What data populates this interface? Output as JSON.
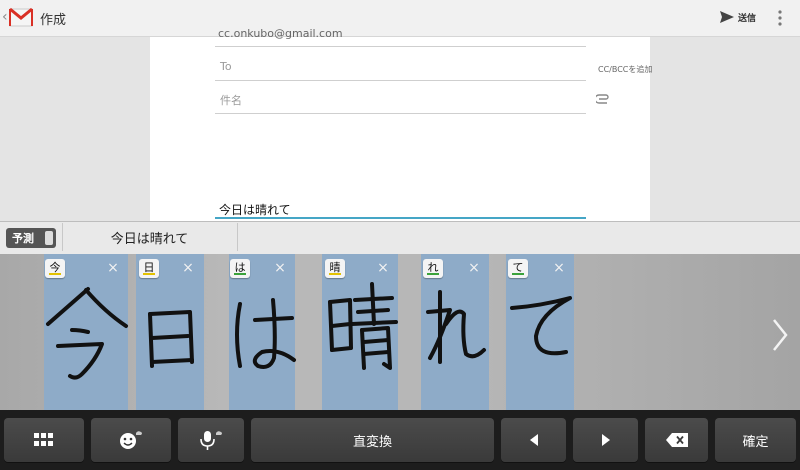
{
  "header": {
    "title": "作成",
    "send_label": "送信",
    "app_icon": "gmail-icon"
  },
  "compose": {
    "from_value": "cc.onkubo@gmail.com",
    "to_placeholder": "To",
    "cc_bcc_label": "CC/BCCを追加",
    "subject_placeholder": "件名",
    "body_text": "今日は晴れて"
  },
  "candidate_bar": {
    "toggle_label": "予測",
    "candidate": "今日は晴れて"
  },
  "handwriting": {
    "chars": [
      {
        "label": "今",
        "underline": "#e3c200"
      },
      {
        "label": "日",
        "underline": "#e3c200"
      },
      {
        "label": "は",
        "underline": "#3aa23a"
      },
      {
        "label": "晴",
        "underline": "#e3c200"
      },
      {
        "label": "れ",
        "underline": "#3aa23a"
      },
      {
        "label": "て",
        "underline": "#3aa23a"
      }
    ],
    "remove_glyph": "×"
  },
  "keyboard": {
    "convert_label": "直変換",
    "confirm_label": "確定"
  },
  "colors": {
    "accent": "#45a6c6",
    "box": "#8eabc8",
    "gmail_red": "#d93025"
  }
}
